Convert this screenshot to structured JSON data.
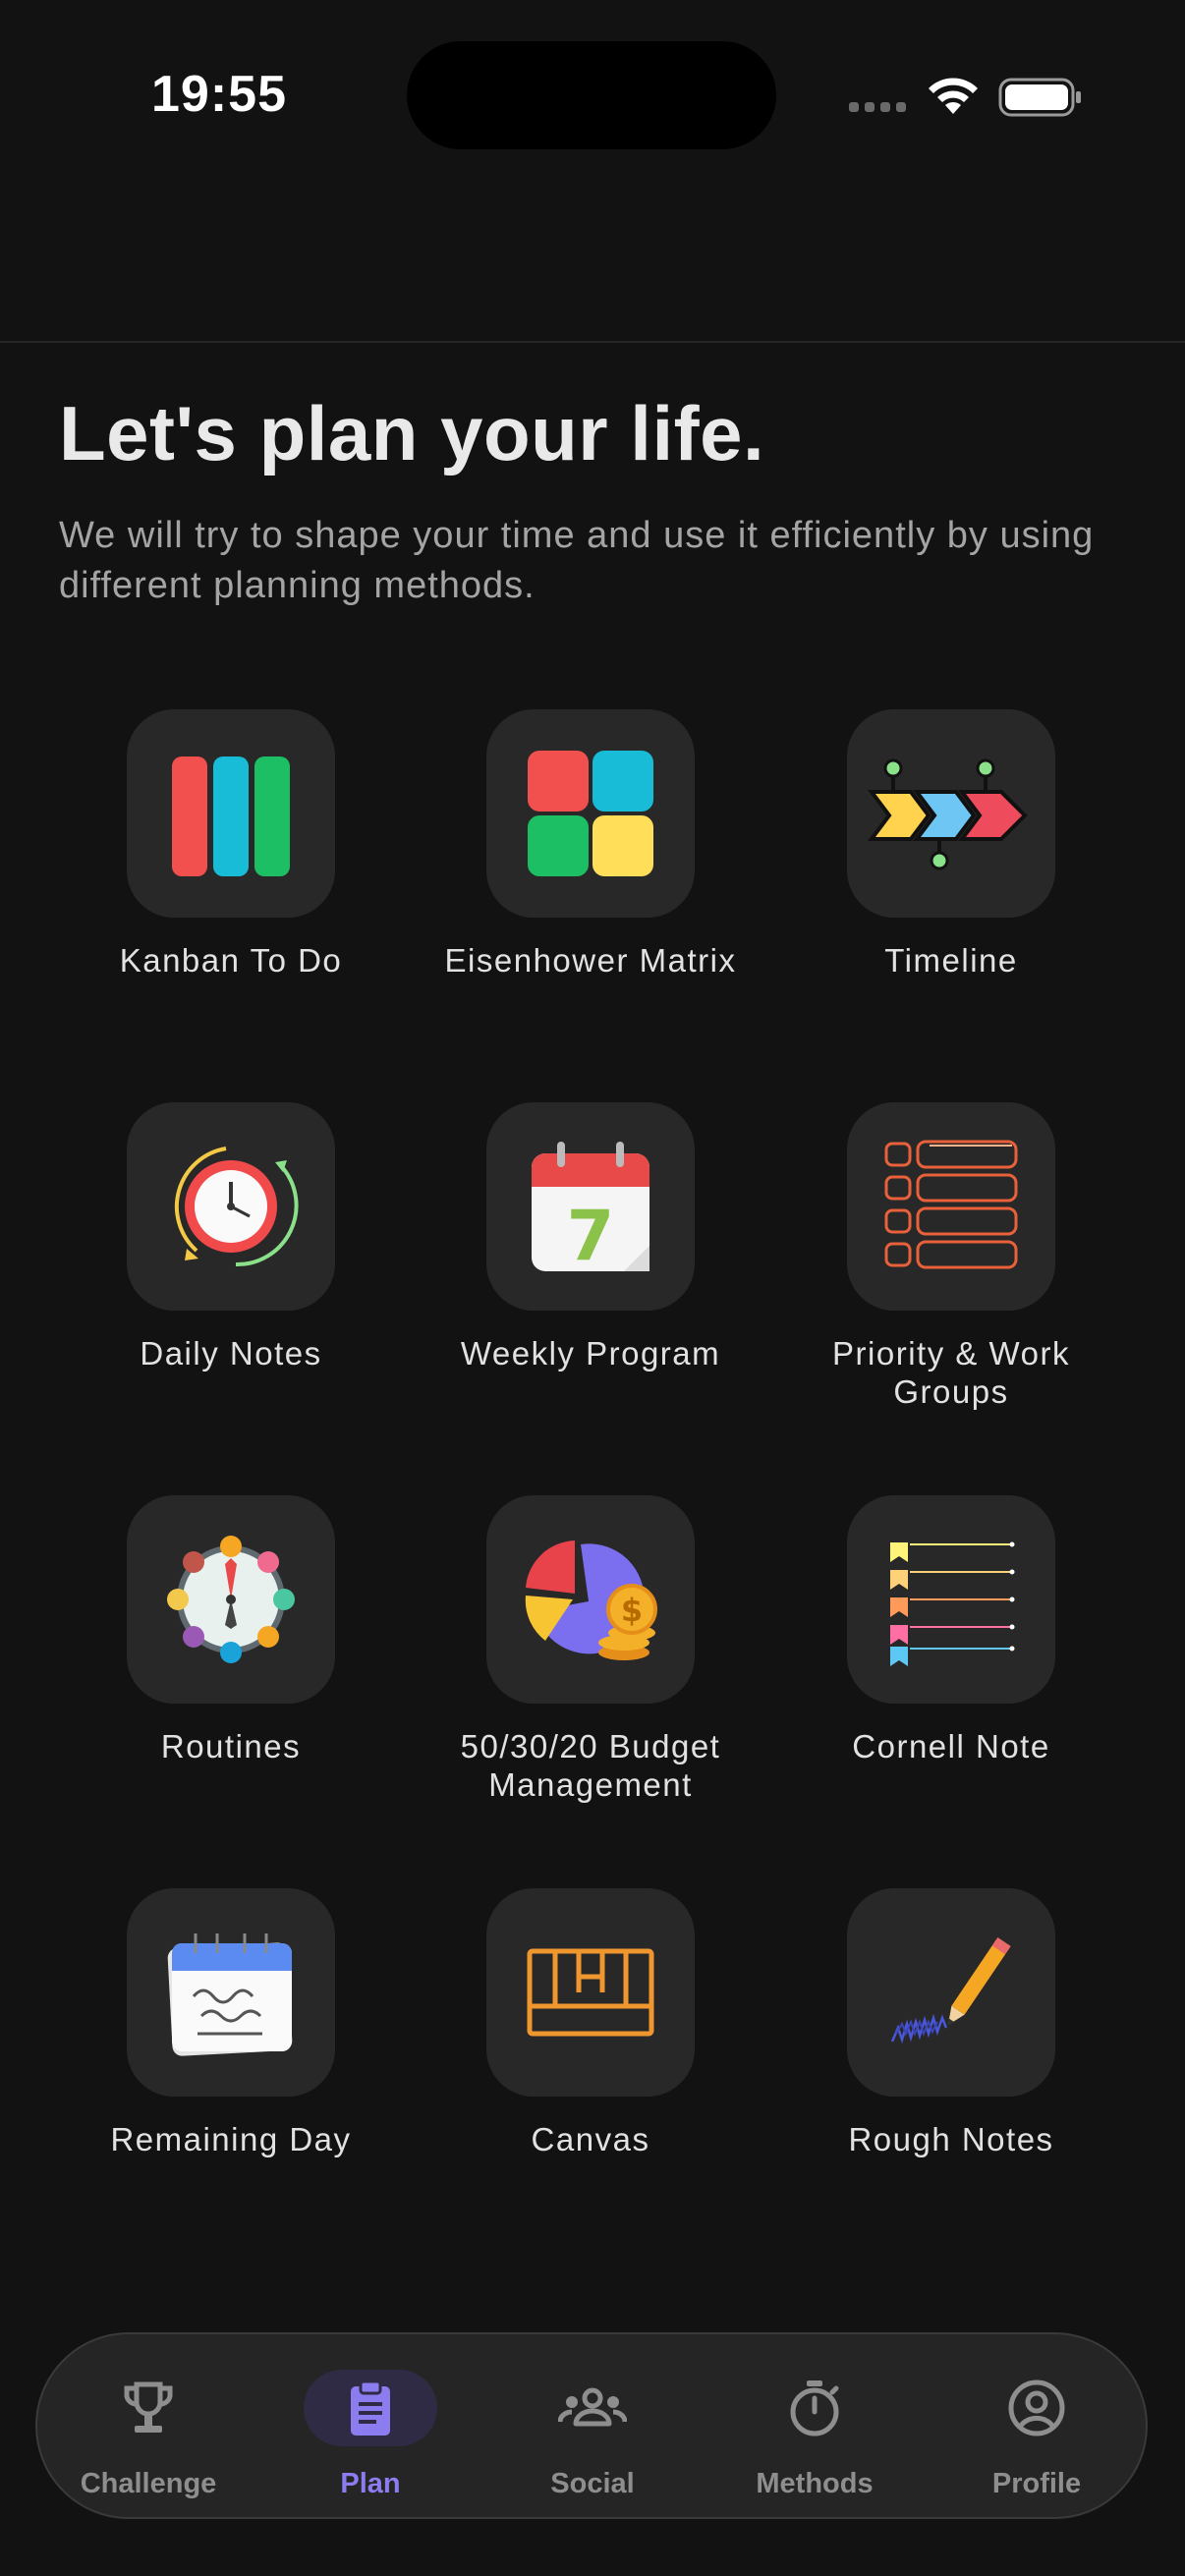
{
  "status_bar": {
    "time": "19:55"
  },
  "header": {
    "title": "Let's plan your life.",
    "subtitle": "We will try to shape your time and use it efficiently by using different planning methods."
  },
  "methods": [
    {
      "label": "Kanban To Do",
      "icon": "kanban-icon"
    },
    {
      "label": "Eisenhower Matrix",
      "icon": "eisenhower-matrix-icon"
    },
    {
      "label": "Timeline",
      "icon": "timeline-icon"
    },
    {
      "label": "Daily Notes",
      "icon": "clock-icon"
    },
    {
      "label": "Weekly Program",
      "icon": "calendar-icon"
    },
    {
      "label": "Priority & Work Groups",
      "icon": "priority-list-icon"
    },
    {
      "label": "Routines",
      "icon": "routine-clock-icon"
    },
    {
      "label": "50/30/20 Budget Management",
      "icon": "pie-chart-coins-icon"
    },
    {
      "label": "Cornell Note",
      "icon": "cornell-note-icon"
    },
    {
      "label": "Remaining Day",
      "icon": "notepad-calendar-icon"
    },
    {
      "label": "Canvas",
      "icon": "canvas-grid-icon"
    },
    {
      "label": "Rough Notes",
      "icon": "pencil-scribble-icon"
    }
  ],
  "tabbar": {
    "active": "Plan",
    "accent_color": "#8b7cf0",
    "items": [
      {
        "label": "Challenge",
        "icon": "trophy-icon"
      },
      {
        "label": "Plan",
        "icon": "clipboard-icon"
      },
      {
        "label": "Social",
        "icon": "people-icon"
      },
      {
        "label": "Methods",
        "icon": "stopwatch-icon"
      },
      {
        "label": "Profile",
        "icon": "user-circle-icon"
      }
    ]
  }
}
